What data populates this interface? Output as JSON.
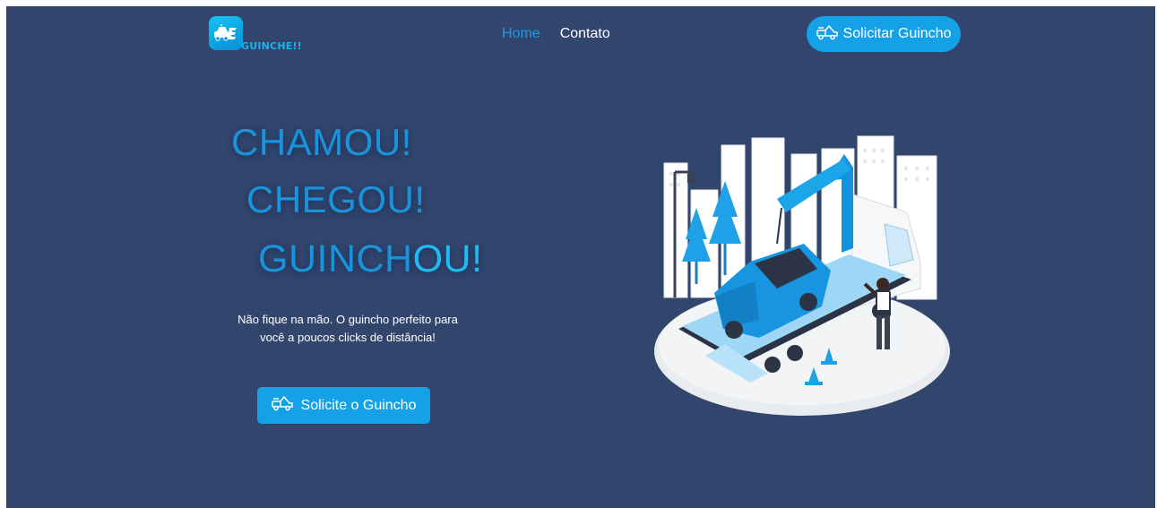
{
  "brand": {
    "name": "GUINCHE!!"
  },
  "nav": {
    "items": [
      {
        "label": "Home",
        "active": true
      },
      {
        "label": "Contato",
        "active": false
      }
    ]
  },
  "header_cta": {
    "label": "Solicitar Guincho",
    "icon": "tow-truck-icon"
  },
  "hero": {
    "line1": "CHAMOU!",
    "line2": "CHEGOU!",
    "line3_part1": "GUINCH",
    "line3_part2": "OU!",
    "tagline": "Não fique na mão. O guincho perfeito para você a poucos clicks de distância!",
    "cta_label": "Solicite o Guincho",
    "cta_icon": "tow-truck-icon",
    "illustration": "tow-truck-illustration"
  },
  "colors": {
    "background": "#31456d",
    "accent": "#15a1e7",
    "heading": "#1a93da",
    "nav_active": "#1c9ce6"
  }
}
